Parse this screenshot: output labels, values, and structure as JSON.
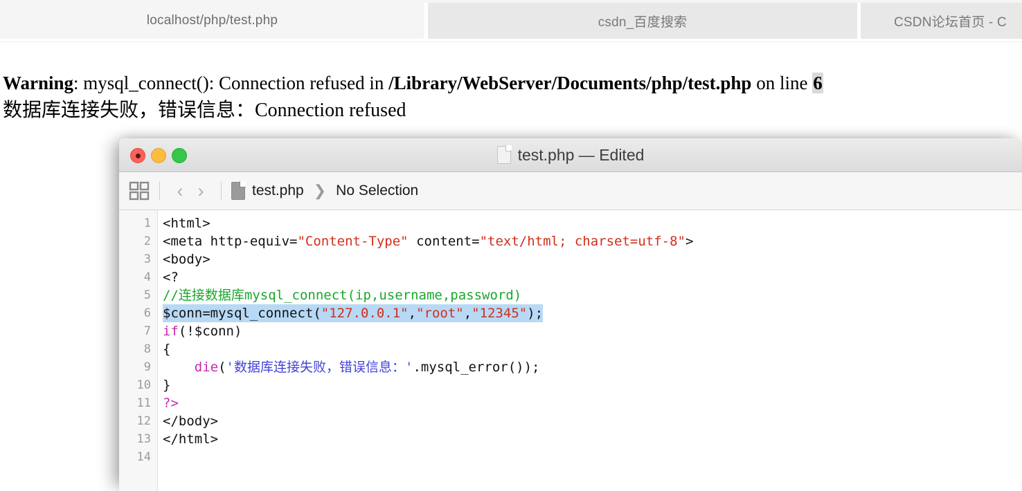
{
  "browser": {
    "tabs": [
      {
        "label": "localhost/php/test.php",
        "active": true
      },
      {
        "label": "csdn_百度搜索",
        "active": false
      },
      {
        "label": "CSDN论坛首页 - C",
        "active": false
      }
    ]
  },
  "page_output": {
    "warning_label": "Warning",
    "warning_mid": ": mysql_connect(): Connection refused in ",
    "warning_path": "/Library/WebServer/Documents/php/test.php",
    "warning_on_line": " on line ",
    "warning_line_number": "6",
    "second_line": "数据库连接失败，错误信息：Connection refused",
    "highlight_color": "#d9d9d9"
  },
  "editor": {
    "window_title": "test.php — Edited",
    "title_icon": "document-icon",
    "traffic_lights": {
      "close": "close-button",
      "minimize": "minimize-button",
      "maximize": "maximize-button",
      "close_color": "#fc6058",
      "minimize_color": "#fdbc40",
      "maximize_color": "#34c749"
    },
    "toolbar": {
      "grid_icon": "panels-grid-icon",
      "back_icon": "‹",
      "forward_icon": "›",
      "crumb_file": "test.php",
      "crumb_sep": "❯",
      "crumb_selection": "No Selection"
    },
    "selected_line": 6,
    "selection_color": "#b7d9f5",
    "line_numbers": [
      "1",
      "2",
      "3",
      "4",
      "5",
      "6",
      "7",
      "8",
      "9",
      "10",
      "11",
      "12",
      "13",
      "14"
    ],
    "code_lines": [
      {
        "n": "1",
        "plain": "<html>"
      },
      {
        "n": "2",
        "plain": "<meta http-equiv=\"Content-Type\" content=\"text/html; charset=utf-8\">"
      },
      {
        "n": "3",
        "plain": "<body>"
      },
      {
        "n": "4",
        "plain": "<?"
      },
      {
        "n": "5",
        "plain": "//连接数据库mysql_connect(ip,username,password)"
      },
      {
        "n": "6",
        "plain": "$conn=mysql_connect(\"127.0.0.1\",\"root\",\"12345\");"
      },
      {
        "n": "7",
        "plain": "if(!$conn)"
      },
      {
        "n": "8",
        "plain": "{"
      },
      {
        "n": "9",
        "plain": "    die('数据库连接失败，错误信息：'.mysql_error());"
      },
      {
        "n": "10",
        "plain": "}"
      },
      {
        "n": "11",
        "plain": "?>"
      },
      {
        "n": "12",
        "plain": "</body>"
      },
      {
        "n": "13",
        "plain": "</html>"
      },
      {
        "n": "14",
        "plain": ""
      }
    ],
    "line2_parts": {
      "a": "<meta http-equiv=",
      "b": "\"Content-Type\"",
      "c": " content=",
      "d": "\"text/html; charset=utf-8\"",
      "e": ">"
    },
    "line5_comment": "//连接数据库mysql_connect(ip,username,password)",
    "line6_parts": {
      "a": "$conn=mysql_connect(",
      "b": "\"127.0.0.1\"",
      "c": ",",
      "d": "\"root\"",
      "e": ",",
      "f": "\"12345\"",
      "g": ");"
    },
    "line7_parts": {
      "kw": "if",
      "rest": "(!$conn)"
    },
    "line9_parts": {
      "indent": "    ",
      "fn": "die",
      "open": "(",
      "str": "'数据库连接失败，错误信息：'",
      "rest": ".mysql_error());"
    },
    "line11_text": "?>",
    "colors": {
      "string_red": "#d12f1b",
      "string_blue": "#4343d8",
      "comment_green": "#1aa72b",
      "keyword_magenta": "#c629b0",
      "text_black": "#111111",
      "gutter_text": "#9b9b9b"
    }
  }
}
